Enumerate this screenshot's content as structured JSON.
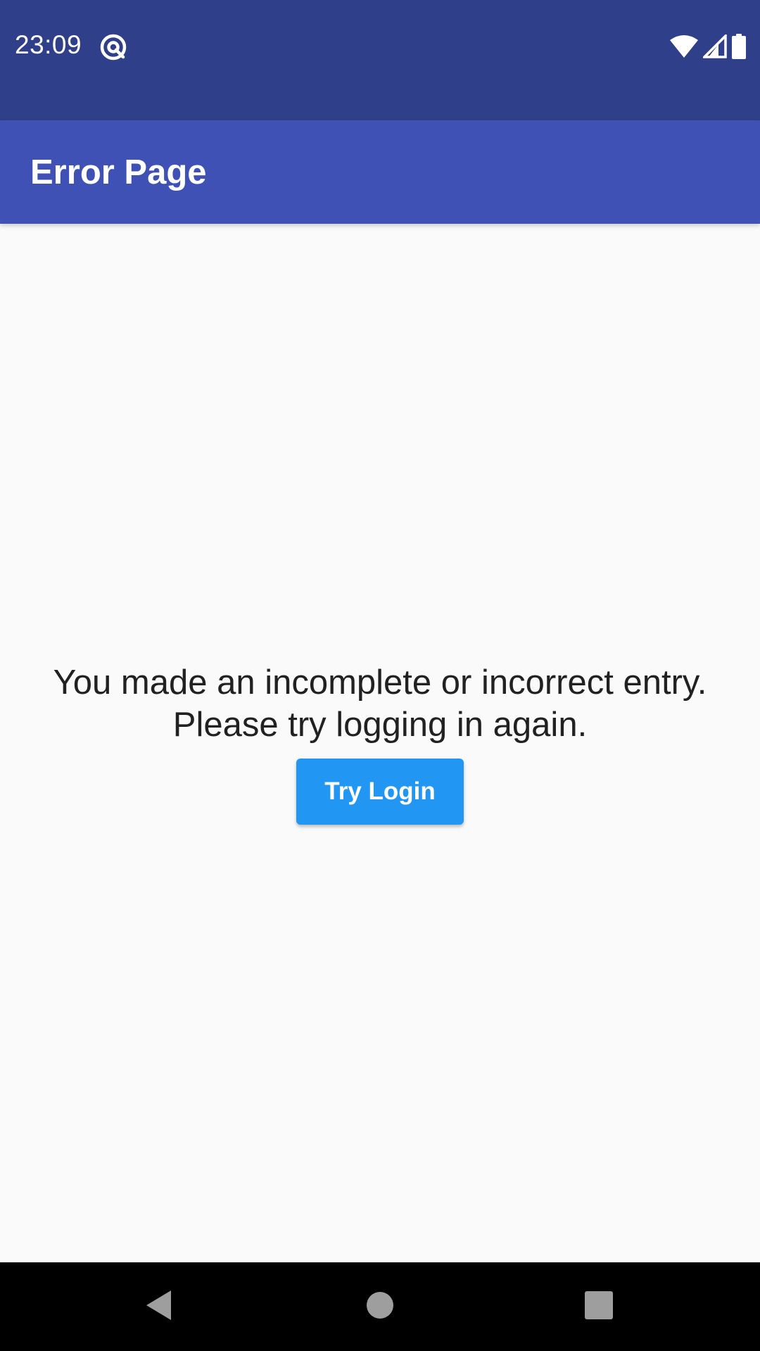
{
  "status_bar": {
    "time": "23:09",
    "app_icon": "at-sign-icon",
    "wifi_icon": "wifi-icon",
    "signal_icon": "cell-signal-icon",
    "battery_icon": "battery-icon",
    "background_color": "#303f8a"
  },
  "app_bar": {
    "title": "Error Page",
    "background_color": "#3f51b5"
  },
  "main": {
    "message_line1": "You made an incomplete or incorrect entry.",
    "message_line2": "Please try logging in again.",
    "button_label": "Try Login",
    "button_color": "#2196f3"
  },
  "nav_bar": {
    "back_icon": "back-triangle-icon",
    "home_icon": "home-circle-icon",
    "recents_icon": "recents-square-icon"
  }
}
